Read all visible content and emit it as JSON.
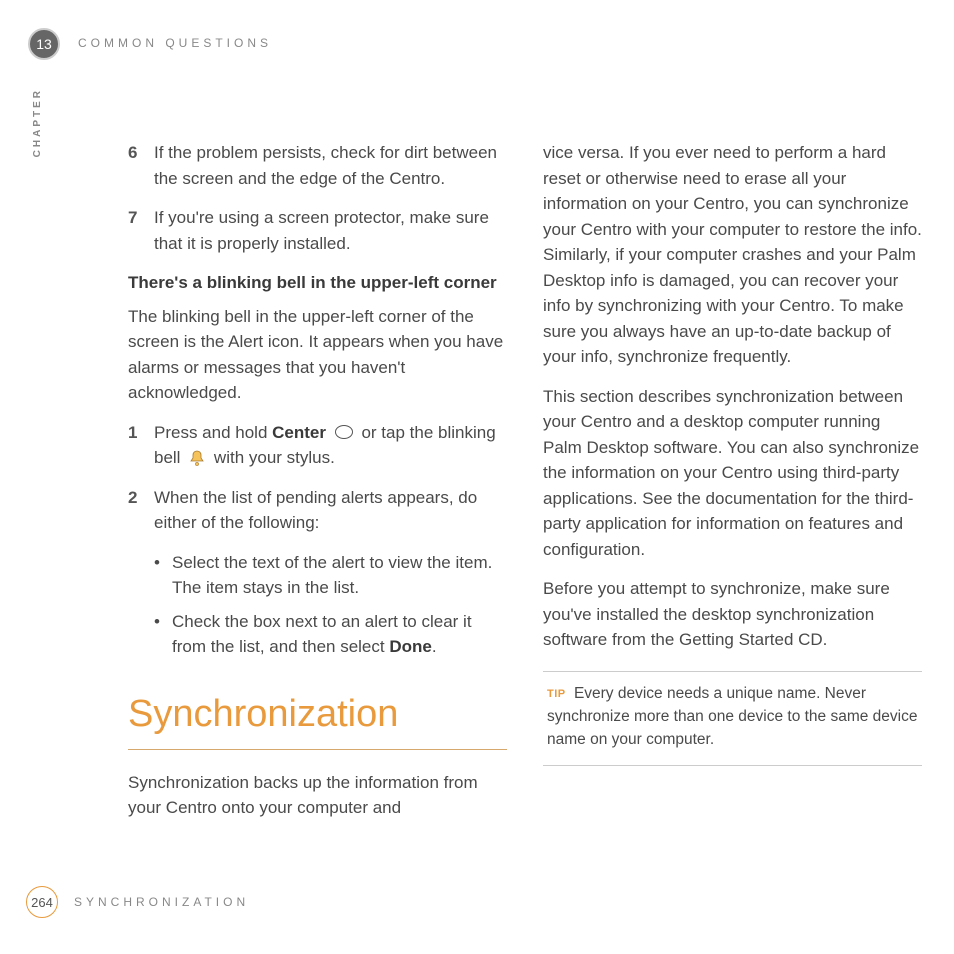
{
  "header": {
    "chapter_number": "13",
    "chapter_label": "COMMON QUESTIONS",
    "side_label": "CHAPTER"
  },
  "left": {
    "item6_num": "6",
    "item6_text": "If the problem persists, check for dirt between the screen and the edge of the Centro.",
    "item7_num": "7",
    "item7_text": "If you're using a screen protector, make sure that it is properly installed.",
    "subhead": "There's a blinking bell in the upper-left corner",
    "para1": "The blinking bell in the upper-left corner of the screen is the Alert icon. It appears when you have alarms or messages that you haven't acknowledged.",
    "step1_num": "1",
    "step1_a": "Press and hold ",
    "step1_bold": "Center",
    "step1_b": " or tap the blinking bell ",
    "step1_c": " with your stylus.",
    "step2_num": "2",
    "step2_text": "When the list of pending alerts appears, do either of the following:",
    "bullet1": "Select the text of the alert to view the item. The item stays in the list.",
    "bullet2_a": "Check the box next to an alert to clear it from the list, and then select ",
    "bullet2_bold": "Done",
    "bullet2_b": ".",
    "section_title": "Synchronization",
    "para2": "Synchronization backs up the information from your Centro onto your computer and"
  },
  "right": {
    "para1": "vice versa. If you ever need to perform a hard reset or otherwise need to erase all your information on your Centro, you can synchronize your Centro with your computer to restore the info. Similarly, if your computer crashes and your Palm Desktop info is damaged, you can recover your info by synchronizing with your Centro. To make sure you always have an up-to-date backup of your info, synchronize frequently.",
    "para2": "This section describes synchronization between your Centro and a desktop computer running Palm Desktop software. You can also synchronize the information on your Centro using third-party applications. See the documentation for the third-party application for information on features and configuration.",
    "para3": "Before you attempt to synchronize, make sure you've installed the desktop synchronization software from the Getting Started CD.",
    "tip_label": "TIP",
    "tip_text": "Every device needs a unique name. Never synchronize more than one device to the same device name on your computer."
  },
  "footer": {
    "page_number": "264",
    "label": "SYNCHRONIZATION"
  }
}
